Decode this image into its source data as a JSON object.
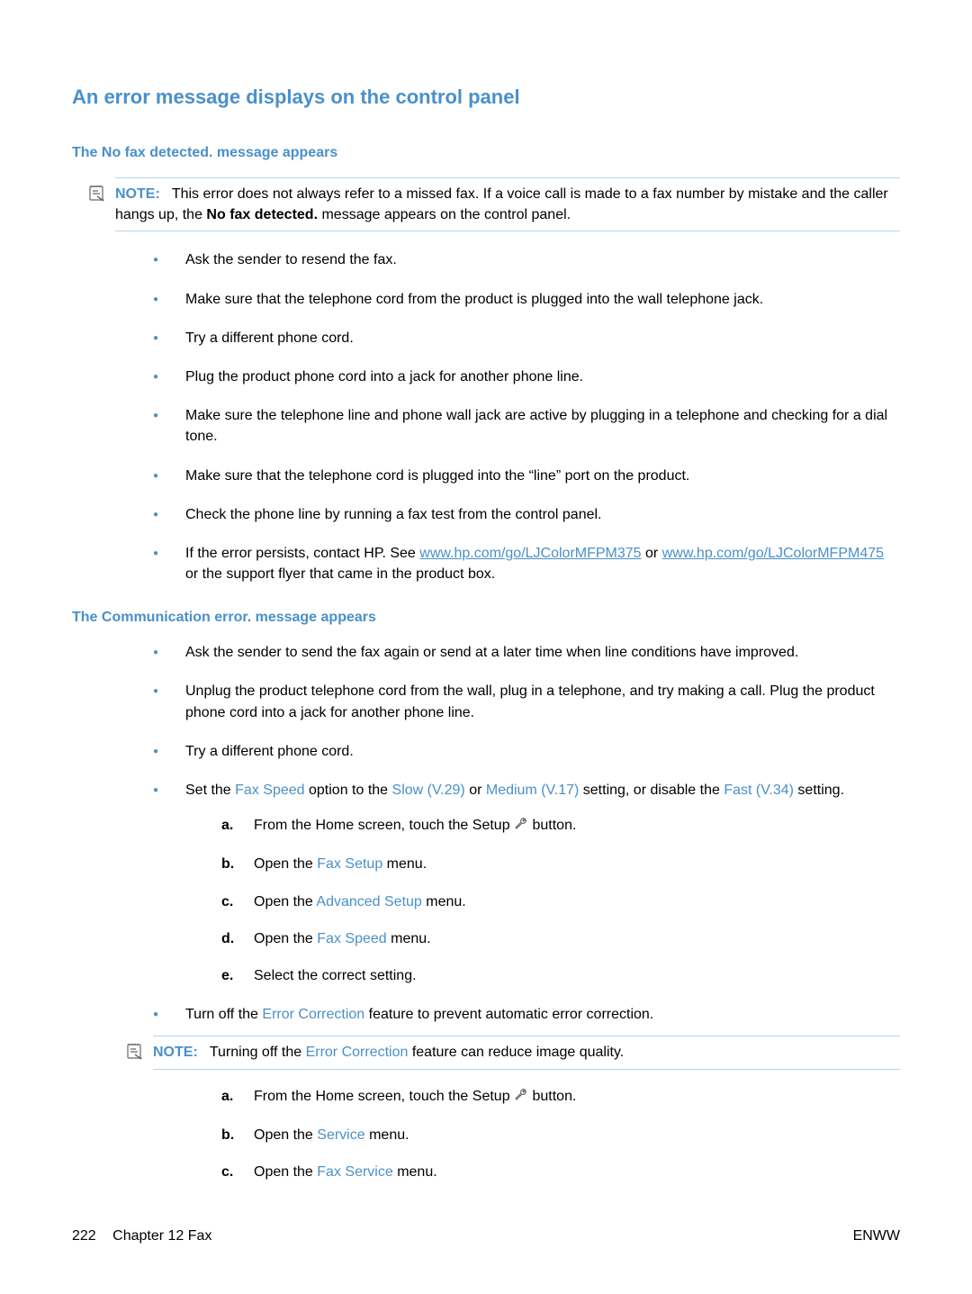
{
  "heading": "An error message displays on the control panel",
  "section1": {
    "title": "The No fax detected. message appears",
    "note": {
      "label": "NOTE:",
      "text_before": "This error does not always refer to a missed fax. If a voice call is made to a fax number by mistake and the caller hangs up, the ",
      "bold": "No fax detected.",
      "text_after": " message appears on the control panel."
    },
    "bullets": {
      "b1": "Ask the sender to resend the fax.",
      "b2": "Make sure that the telephone cord from the product is plugged into the wall telephone jack.",
      "b3": "Try a different phone cord.",
      "b4": "Plug the product phone cord into a jack for another phone line.",
      "b5": "Make sure the telephone line and phone wall jack are active by plugging in a telephone and checking for a dial tone.",
      "b6": "Make sure that the telephone cord is plugged into the “line” port on the product.",
      "b7": "Check the phone line by running a fax test from the control panel.",
      "b8_pre": "If the error persists, contact HP. See ",
      "b8_link1": "www.hp.com/go/LJColorMFPM375",
      "b8_mid": " or ",
      "b8_link2a": "www.hp.com/go/",
      "b8_link2b": "LJColorMFPM475",
      "b8_post": " or the support flyer that came in the product box."
    }
  },
  "section2": {
    "title": "The Communication error. message appears",
    "bullets": {
      "b1": "Ask the sender to send the fax again or send at a later time when line conditions have improved.",
      "b2": "Unplug the product telephone cord from the wall, plug in a telephone, and try making a call. Plug the product phone cord into a jack for another phone line.",
      "b3": "Try a different phone cord.",
      "b4_pre": "Set the ",
      "b4_t1": "Fax Speed",
      "b4_m1": " option to the ",
      "b4_t2": "Slow (V.29)",
      "b4_m2": " or ",
      "b4_t3": "Medium (V.17)",
      "b4_m3": " setting, or disable the ",
      "b4_t4": "Fast (V.34)",
      "b4_post": " setting.",
      "steps1": {
        "a_pre": "From the Home screen, touch the Setup ",
        "a_post": " button.",
        "b_pre": "Open the ",
        "b_term": "Fax Setup",
        "b_post": " menu.",
        "c_pre": "Open the ",
        "c_term": "Advanced Setup",
        "c_post": " menu.",
        "d_pre": "Open the ",
        "d_term": "Fax Speed",
        "d_post": " menu.",
        "e": "Select the correct setting."
      },
      "b5_pre": "Turn off the ",
      "b5_term": "Error Correction",
      "b5_post": " feature to prevent automatic error correction.",
      "note2": {
        "label": "NOTE:",
        "pre": "Turning off the ",
        "term": "Error Correction",
        "post": " feature can reduce image quality."
      },
      "steps2": {
        "a_pre": "From the Home screen, touch the Setup ",
        "a_post": " button.",
        "b_pre": "Open the ",
        "b_term": "Service",
        "b_post": " menu.",
        "c_pre": "Open the ",
        "c_term": "Fax Service",
        "c_post": " menu."
      }
    }
  },
  "footer": {
    "page": "222",
    "chapter": "Chapter 12   Fax",
    "right": "ENWW"
  },
  "letters": {
    "a": "a.",
    "b": "b.",
    "c": "c.",
    "d": "d.",
    "e": "e."
  }
}
